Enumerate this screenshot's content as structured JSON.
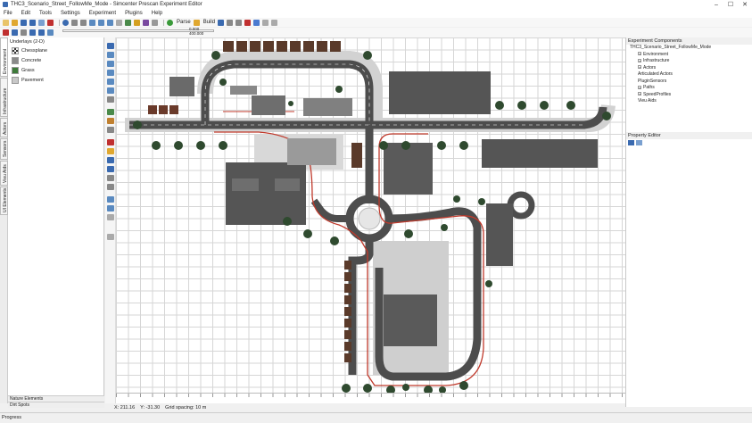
{
  "window": {
    "title": "THC3_Scenario_Street_FollowMe_Mode - Simcenter Prescan Experiment Editor"
  },
  "menu": [
    "File",
    "Edit",
    "Tools",
    "Settings",
    "Experiment",
    "Plugins",
    "Help"
  ],
  "toolbar": {
    "parse_label": "Parse",
    "build_label": "Build",
    "time_value": "0.000",
    "time_total": "400.000"
  },
  "vertical_tabs": [
    "Environment",
    "Infrastructure",
    "Actors",
    "Sensors",
    "Vieu Aids",
    "UI Elements"
  ],
  "left_panel": {
    "header": "Underlays (2-D)",
    "items": [
      {
        "label": "Chessplane",
        "color": "#4a4a4a"
      },
      {
        "label": "Concrete",
        "color": "#8a8a8a"
      },
      {
        "label": "Grass",
        "color": "#3e7a3a"
      },
      {
        "label": "Pavement",
        "color": "#c8c8c8"
      }
    ],
    "bottom_1": "Nature Elements",
    "bottom_2": "Dirt Spots"
  },
  "coords": {
    "x": "X: 211.16",
    "y": "Y: -31.30",
    "grid": "Grid spacing: 10 m"
  },
  "right_panel": {
    "components_title": "Experiment Components",
    "tree": [
      {
        "label": "THC3_Scenario_Street_FollowMe_Mode",
        "level": 0,
        "expander": false
      },
      {
        "label": "Environment",
        "level": 1,
        "expander": true
      },
      {
        "label": "Infrastructure",
        "level": 1,
        "expander": true
      },
      {
        "label": "Actors",
        "level": 1,
        "expander": true
      },
      {
        "label": "Articulated Actors",
        "level": 1,
        "expander": false
      },
      {
        "label": "PluginSensors",
        "level": 1,
        "expander": false
      },
      {
        "label": "Paths",
        "level": 1,
        "expander": true
      },
      {
        "label": "SpeedProfiles",
        "level": 1,
        "expander": true
      },
      {
        "label": "Vieu Aids",
        "level": 1,
        "expander": false
      }
    ],
    "property_title": "Property Editor"
  },
  "status": {
    "progress_label": "Progress"
  },
  "colors": {
    "road": "#4d4d4d",
    "sidewalk": "#d2d2d2",
    "building": "#555555",
    "roof_brown": "#5a3a2a",
    "path_red": "#c0392b",
    "tree": "#2f4a2f"
  }
}
